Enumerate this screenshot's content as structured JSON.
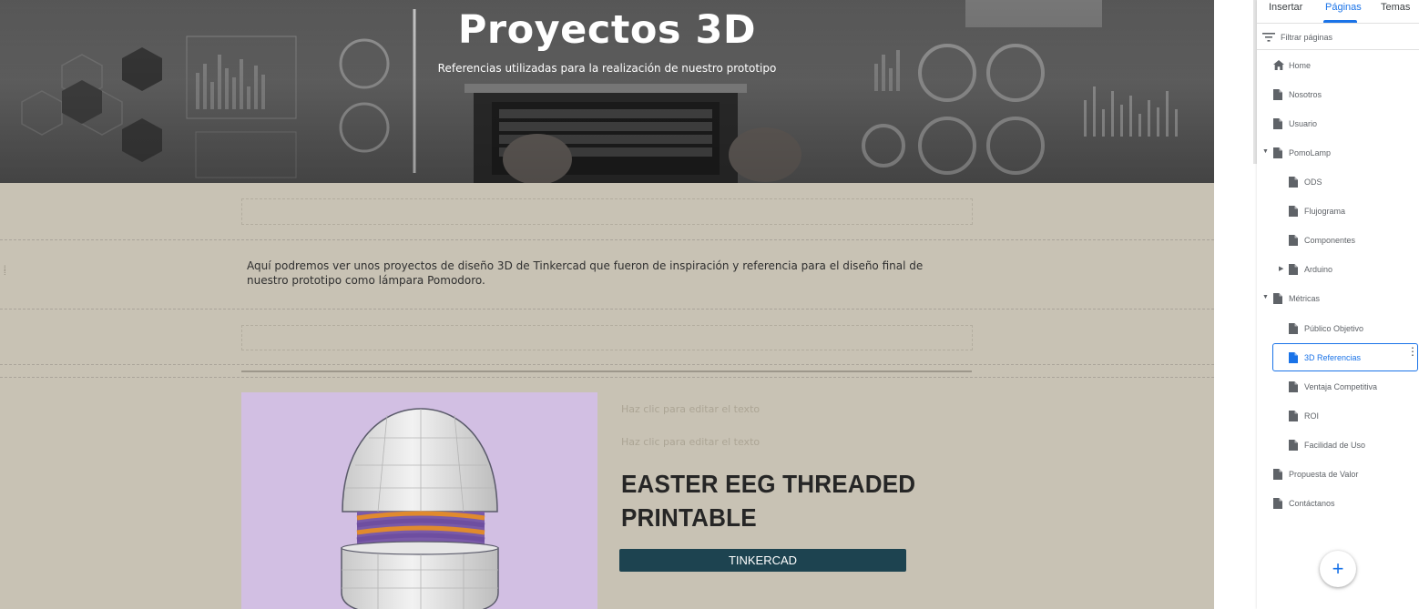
{
  "hero": {
    "title": "Proyectos 3D",
    "subtitle": "Referencias utilizadas para la realización de nuestro prototipo"
  },
  "content": {
    "intro_text": "Aquí podremos ver unos proyectos de diseño 3D de Tinkercad que fueron de inspiración y referencia para el diseño final de nuestro prototipo como lámpara Pomodoro.",
    "placeholder_1": "Haz clic para editar el texto",
    "placeholder_2": "Haz clic para editar el texto",
    "project_title": "EASTER EEG THREADED PRINTABLE",
    "button_label": "TINKERCAD"
  },
  "panel": {
    "tabs": [
      {
        "label": "Insertar"
      },
      {
        "label": "Páginas"
      },
      {
        "label": "Temas"
      }
    ],
    "active_tab": "Páginas",
    "filter_label": "Filtrar páginas",
    "pages": [
      {
        "label": "Home",
        "icon": "home-icon"
      },
      {
        "label": "Nosotros",
        "icon": "page-icon"
      },
      {
        "label": "Usuario",
        "icon": "page-icon"
      },
      {
        "label": "PomoLamp",
        "icon": "page-icon",
        "expanded": true
      },
      {
        "label": "ODS",
        "icon": "page-icon"
      },
      {
        "label": "Flujograma",
        "icon": "page-icon"
      },
      {
        "label": "Componentes",
        "icon": "page-icon"
      },
      {
        "label": "Arduino",
        "icon": "page-icon",
        "expanded": false
      },
      {
        "label": "Métricas",
        "icon": "page-icon",
        "expanded": true
      },
      {
        "label": "Público Objetivo",
        "icon": "page-icon"
      },
      {
        "label": "3D Referencias",
        "icon": "page-icon",
        "selected": true
      },
      {
        "label": "Ventaja Competitiva",
        "icon": "page-icon"
      },
      {
        "label": "ROI",
        "icon": "page-icon"
      },
      {
        "label": "Facilidad de Uso",
        "icon": "page-icon"
      },
      {
        "label": "Propuesta de Valor",
        "icon": "page-icon"
      },
      {
        "label": "Contáctanos",
        "icon": "page-icon"
      }
    ],
    "add_button": "+"
  },
  "colors": {
    "accent": "#1a73e8",
    "canvas_bg": "#c8c2b4",
    "button_bg": "#1d4350",
    "egg_panel_bg": "#d2bfe3"
  }
}
